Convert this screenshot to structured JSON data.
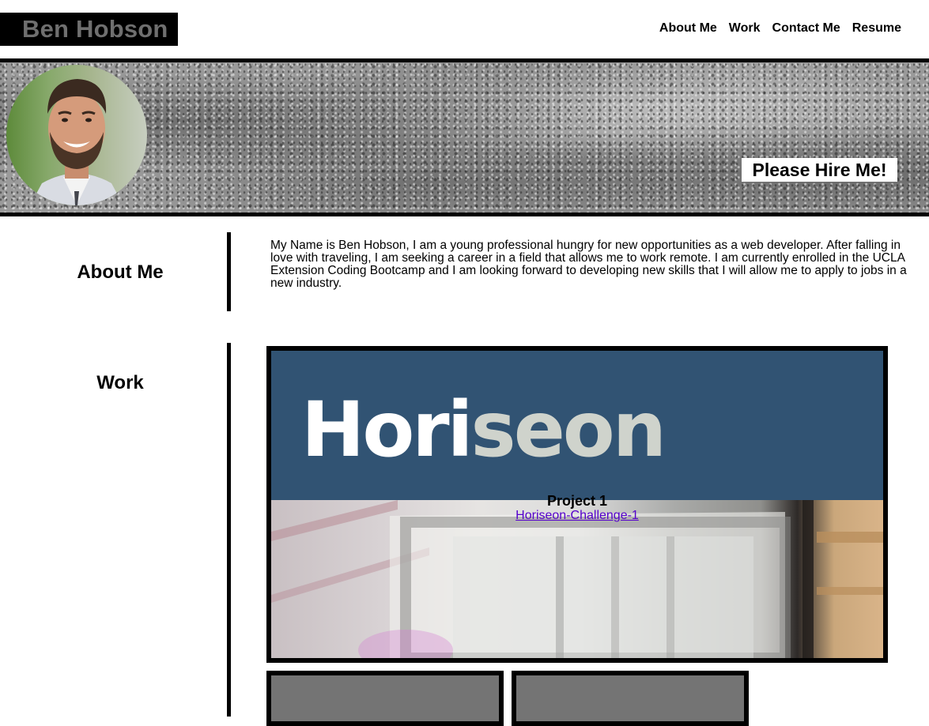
{
  "header": {
    "logo": "Ben Hobson",
    "nav": [
      "About Me",
      "Work",
      "Contact Me",
      "Resume"
    ]
  },
  "hero": {
    "tagline": "Please Hire Me!"
  },
  "about": {
    "title": "About Me",
    "text": "My Name is Ben Hobson, I am a young professional hungry for new opportunities as a web developer. After falling in love with traveling, I am seeking a career in a field that allows me to work remote. I am currently enrolled in the UCLA Extension Coding Bootcamp and I am looking forward to developing new skills that I will allow me to apply to jobs in a new industry."
  },
  "work": {
    "title": "Work",
    "projects": [
      {
        "banner_text_part1": "Hori",
        "banner_text_part2": "seon",
        "title": "Project 1",
        "link": "Horiseon-Challenge-1"
      }
    ]
  },
  "colors": {
    "banner_blue": "#315373",
    "banner_light": "#cfd3cc",
    "link_purple": "#5500cc"
  }
}
